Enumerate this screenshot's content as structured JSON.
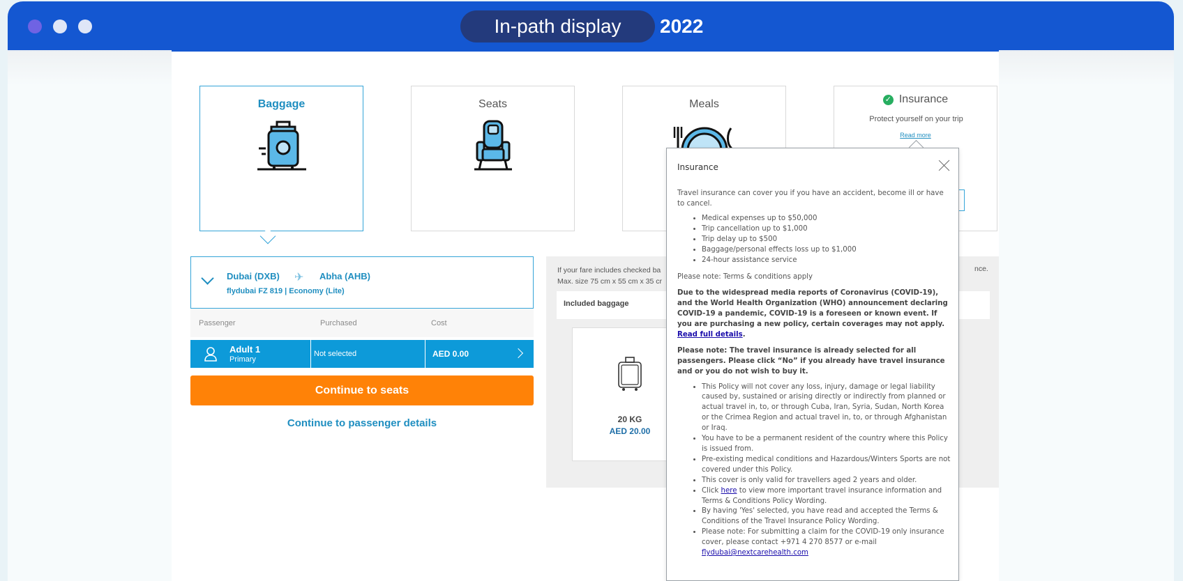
{
  "window": {
    "title": "In-path display",
    "year": "2022"
  },
  "tiles": [
    {
      "label": "Baggage",
      "icon": "suitcase-icon"
    },
    {
      "label": "Seats",
      "icon": "seat-icon"
    },
    {
      "label": "Meals",
      "icon": "plate-icon"
    }
  ],
  "insurance_tile": {
    "label": "Insurance",
    "subtitle": "Protect yourself on your trip",
    "link": "Read more",
    "status_color": "#27ae60"
  },
  "flight": {
    "from": "Dubai (DXB)",
    "to": "Abha (AHB)",
    "details": "flydubai FZ 819 | Economy (Lite)"
  },
  "passenger_table": {
    "headers": [
      "Passenger",
      "Purchased",
      "Cost"
    ],
    "row": {
      "name": "Adult 1",
      "type": "Primary",
      "purchased": "Not selected",
      "cost": "AED 0.00"
    }
  },
  "actions": {
    "continue_label": "Continue to seats",
    "passenger_details_link": "Continue to passenger details"
  },
  "baggage_panel": {
    "info_line1": "If your fare includes checked ba",
    "info_line2": "Max. size 75 cm x 55 cm x 35 cr",
    "info_tail": "nce.",
    "included_label": "Included baggage",
    "option": {
      "weight": "20 KG",
      "price": "AED 20.00"
    }
  },
  "popup": {
    "title": "Insurance",
    "intro": "Travel insurance can cover you if you have an accident, become ill or have to cancel.",
    "coverage": [
      "Medical expenses up to $50,000",
      "Trip cancellation up to $1,000",
      "Trip delay up to $500",
      "Baggage/personal effects loss up to $1,000",
      "24-hour assistance service"
    ],
    "terms_note": "Please note: Terms & conditions apply",
    "covid_text": "Due to the widespread media reports of Coronavirus (COVID-19), and the World Health Organization (WHO) announcement declaring COVID-19 a pandemic, COVID-19 is a foreseen or known event. If you are purchasing a new policy, certain coverages may not apply. ",
    "covid_link": "Read full details",
    "preselected_note": "Please note: The travel insurance is already selected for all passengers. Please click “No” if you already have travel insurance and or you do not wish to buy it.",
    "conditions": [
      "This Policy will not cover any loss, injury, damage or legal liability caused by, sustained or arising directly or indirectly from planned or actual travel in, to, or through Cuba, Iran, Syria, Sudan, North Korea or the Crimea Region and actual travel in, to, or through Afghanistan or Iraq.",
      "You have to be a permanent resident of the country where this Policy is issued from.",
      "Pre-existing medical conditions and Hazardous/Winters Sports are not covered under this Policy.",
      "This cover is only valid for travellers aged 2 years and older."
    ],
    "click_prefix": "Click ",
    "click_link": "here",
    "click_suffix": " to view more important travel insurance information and Terms & Conditions Policy Wording.",
    "accept_note": "By having 'Yes' selected, you have read and accepted the Terms & Conditions of the Travel Insurance Policy Wording.",
    "claim_note": "Please note: For submitting a claim for the COVID-19 only insurance cover, please contact +971 4 270 8577 or e-mail ",
    "claim_email": "flydubai@nextcarehealth.com"
  },
  "colors": {
    "titlebar": "#1457d1",
    "accent_blue": "#0d9ad9",
    "cta_orange": "#ff8207"
  }
}
